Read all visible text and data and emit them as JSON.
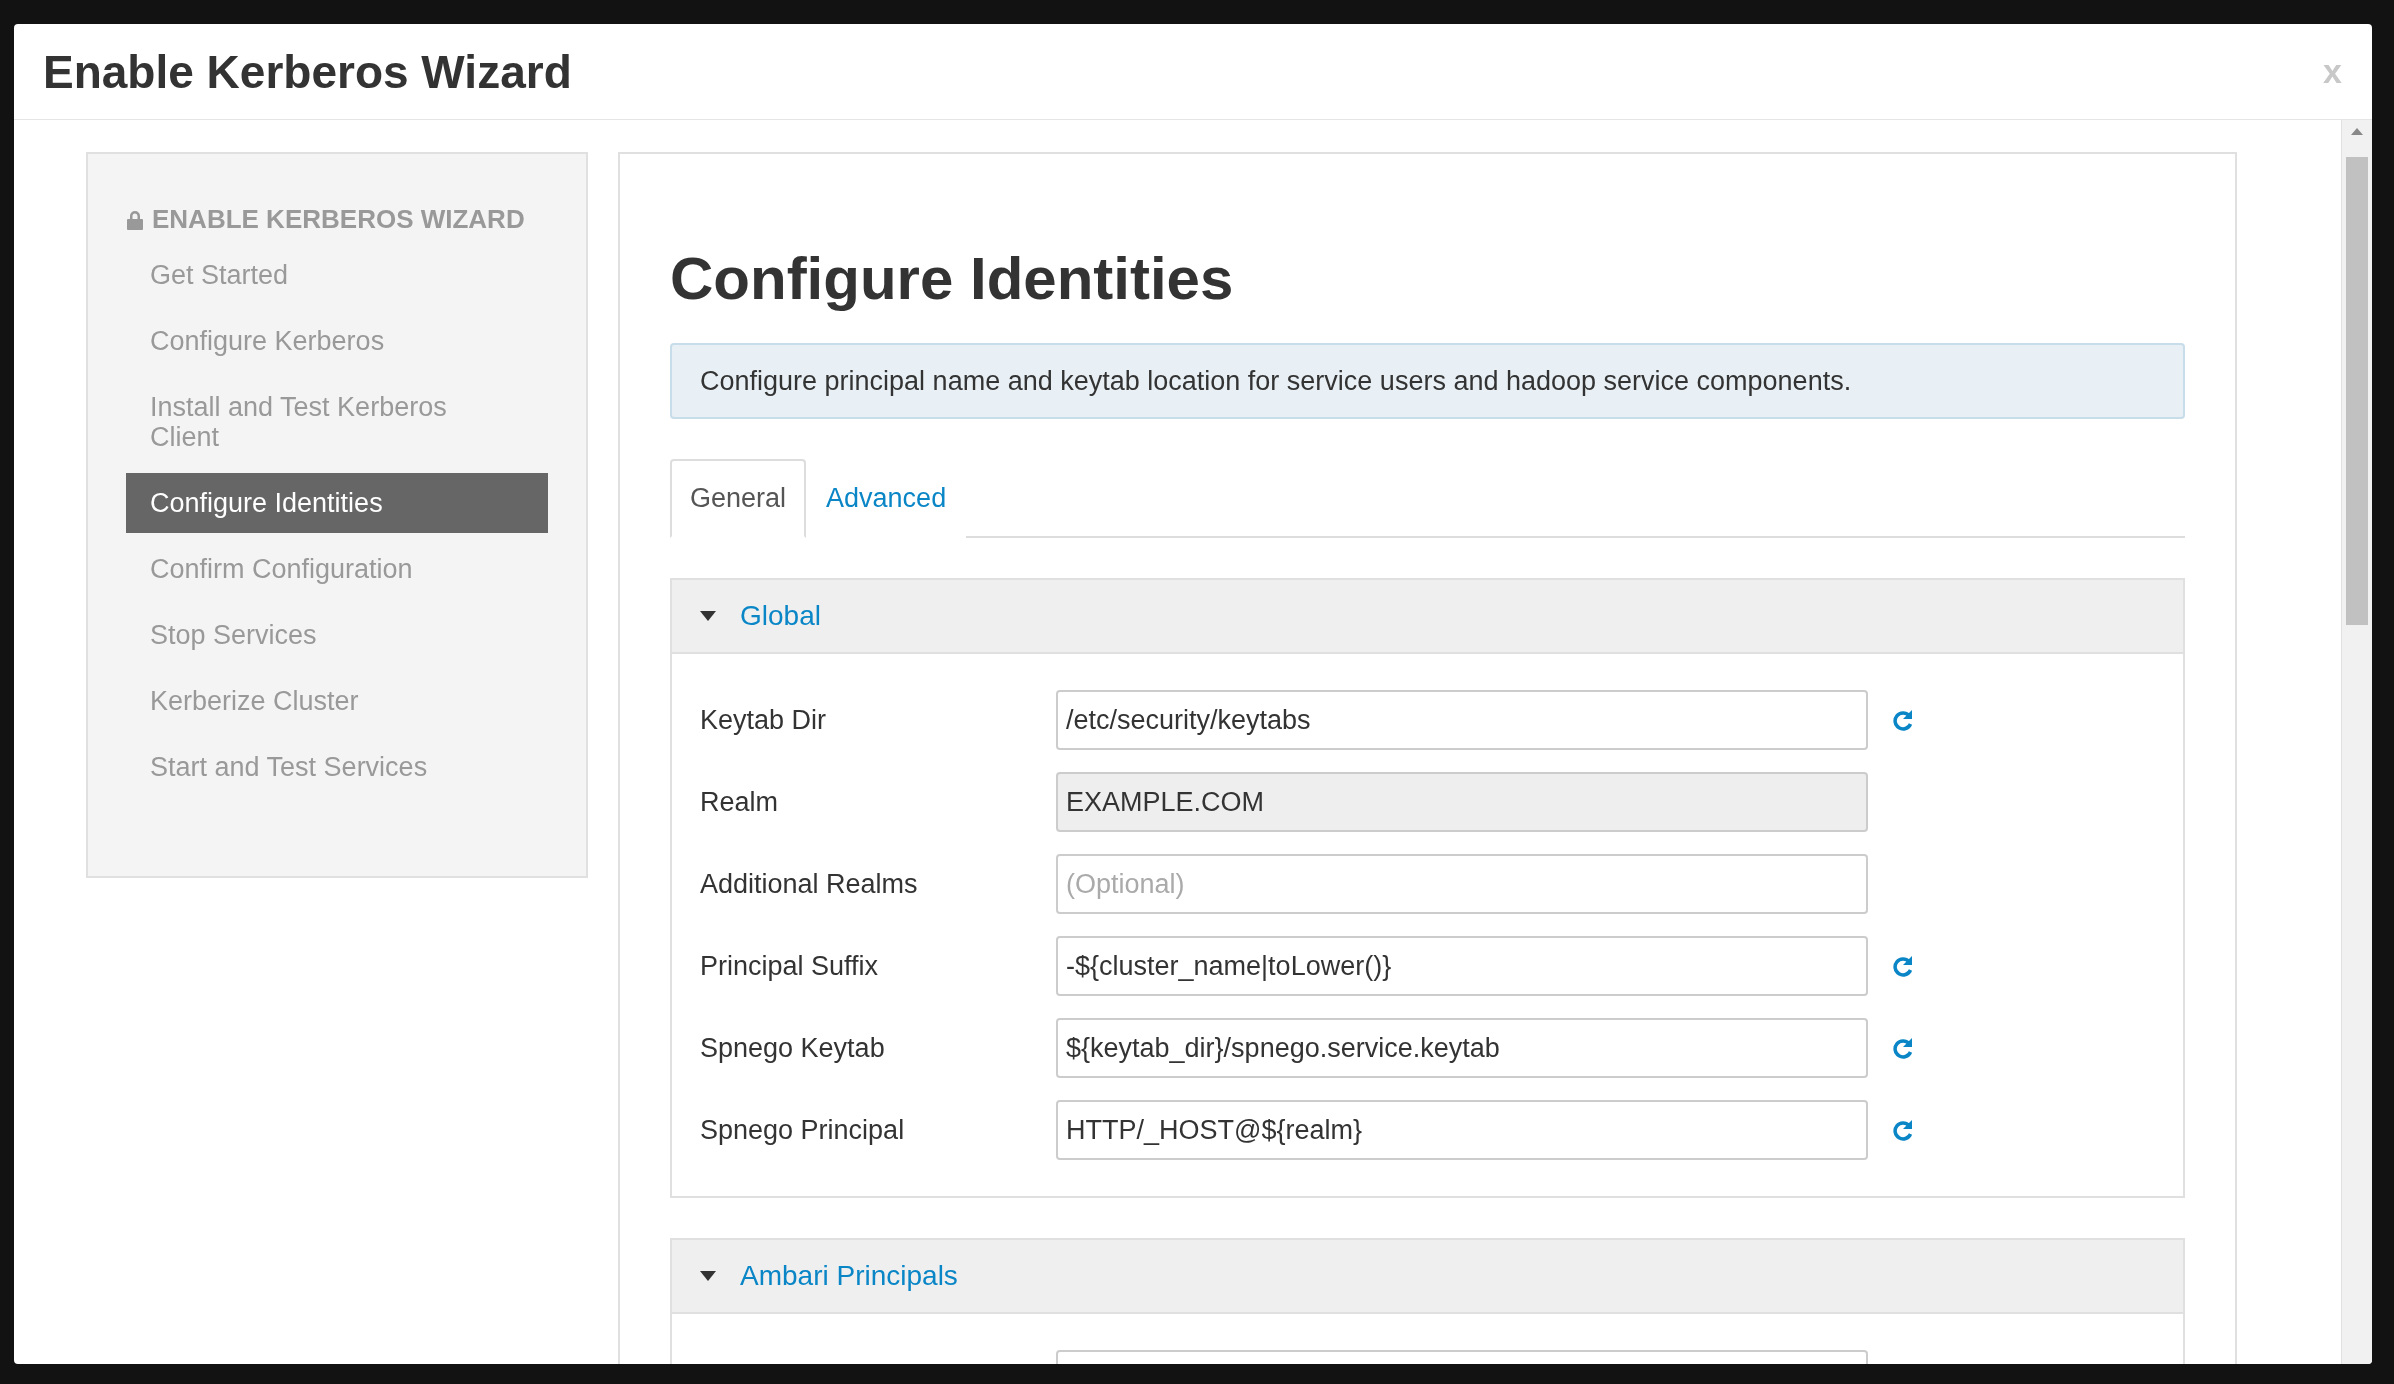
{
  "dialog": {
    "title": "Enable Kerberos Wizard",
    "close": "x"
  },
  "sidebar": {
    "heading": "ENABLE KERBEROS WIZARD",
    "items": [
      {
        "label": "Get Started",
        "selected": false
      },
      {
        "label": "Configure Kerberos",
        "selected": false
      },
      {
        "label": "Install and Test Kerberos Client",
        "selected": false
      },
      {
        "label": "Configure Identities",
        "selected": true
      },
      {
        "label": "Confirm Configuration",
        "selected": false
      },
      {
        "label": "Stop Services",
        "selected": false
      },
      {
        "label": "Kerberize Cluster",
        "selected": false
      },
      {
        "label": "Start and Test Services",
        "selected": false
      }
    ]
  },
  "main": {
    "title": "Configure Identities",
    "info": "Configure principal name and keytab location for service users and hadoop service components.",
    "tabs": [
      {
        "label": "General",
        "selected": true
      },
      {
        "label": "Advanced",
        "selected": false
      }
    ],
    "sections": [
      {
        "title": "Global",
        "expanded": true,
        "fields": [
          {
            "label": "Keytab Dir",
            "value": "/etc/security/keytabs",
            "disabled": false,
            "reset": true
          },
          {
            "label": "Realm",
            "value": "EXAMPLE.COM",
            "disabled": true,
            "reset": false
          },
          {
            "label": "Additional Realms",
            "placeholder": "(Optional)",
            "disabled": false,
            "reset": false
          },
          {
            "label": "Principal Suffix",
            "value": "-${cluster_name|toLower()}",
            "disabled": false,
            "reset": true
          },
          {
            "label": "Spnego Keytab",
            "value": "${keytab_dir}/spnego.service.keytab",
            "disabled": false,
            "reset": true
          },
          {
            "label": "Spnego Principal",
            "value": "HTTP/_HOST@${realm}",
            "disabled": false,
            "reset": true
          }
        ]
      },
      {
        "title": "Ambari Principals",
        "expanded": true,
        "fields": [
          {
            "disabled": false,
            "reset": false
          }
        ]
      }
    ]
  }
}
